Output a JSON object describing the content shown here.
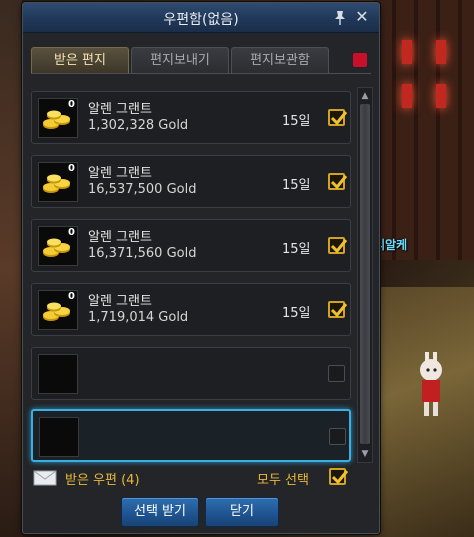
{
  "window": {
    "title": "우편함(없음)"
  },
  "tabs": [
    {
      "label": "받은 편지",
      "active": true
    },
    {
      "label": "편지보내기",
      "active": false
    },
    {
      "label": "편지보관함",
      "active": false
    }
  ],
  "mails": [
    {
      "sender": "알렌 그랜트",
      "amount": "1,302,328 Gold",
      "days": "15일",
      "badge": "0",
      "checked": true
    },
    {
      "sender": "알렌 그랜트",
      "amount": "16,537,500 Gold",
      "days": "15일",
      "badge": "0",
      "checked": true
    },
    {
      "sender": "알렌 그랜트",
      "amount": "16,371,560 Gold",
      "days": "15일",
      "badge": "0",
      "checked": true
    },
    {
      "sender": "알렌 그랜트",
      "amount": "1,719,014 Gold",
      "days": "15일",
      "badge": "0",
      "checked": true
    }
  ],
  "footer": {
    "received_label": "받은 우편 (4)",
    "select_all_label": "모두 선택",
    "select_all_checked": true,
    "receive_selected_button": "선택 받기",
    "close_button": "닫기"
  },
  "background": {
    "player_name": "스페리알케"
  },
  "colors": {
    "accent_gold": "#e8b838",
    "button_blue": "#1f5591",
    "title_blue": "#203858",
    "selection_cyan": "#3ab0e0"
  }
}
